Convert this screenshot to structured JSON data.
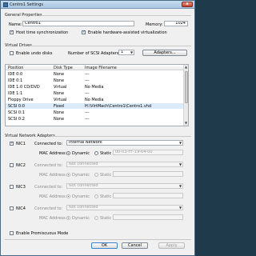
{
  "window": {
    "title": "Centro1 Settings",
    "close_label": "x"
  },
  "general": {
    "group_label": "General Properties",
    "name_label": "Name:",
    "name_value": "Centro1",
    "memory_label": "Memory:",
    "memory_value": "1024",
    "host_time_sync_label": "Host time synchronization",
    "host_time_sync_checked": true,
    "hw_virtualization_label": "Enable hardware-assisted virtualization",
    "hw_virtualization_checked": true
  },
  "virtual_drives": {
    "group_label": "Virtual Drives",
    "undo_disks_label": "Enable undo disks",
    "undo_disks_checked": false,
    "scsi_adapters_label": "Number of SCSI Adapters:",
    "scsi_adapters_value": "1",
    "adapters_button": "Adapters...",
    "columns": [
      "Position",
      "Disk Type",
      "Image Filename"
    ],
    "rows": [
      [
        "IDE 0:0",
        "None",
        "---"
      ],
      [
        "IDE 0:1",
        "None",
        "---"
      ],
      [
        "IDE 1:0 CD/DVD",
        "Virtual",
        "No Media"
      ],
      [
        "IDE 1:1",
        "None",
        "---"
      ],
      [
        "Floppy Drive",
        "Virtual",
        "No Media"
      ],
      [
        "SCSI 0:0",
        "Fixed",
        "H:\\VirtMach\\Centro1\\Centro1.vhd"
      ],
      [
        "SCSI 0:1",
        "None",
        "---"
      ],
      [
        "SCSI 0:2",
        "None",
        "---"
      ]
    ],
    "selected_row": 5
  },
  "network": {
    "group_label": "Virtual Network Adapters",
    "connected_label": "Connected to:",
    "mac_label": "MAC Address:",
    "dynamic_label": "Dynamic",
    "static_label": "Static",
    "adapters": [
      {
        "name": "NIC1",
        "checked": true,
        "connected_to": "Internal Network",
        "mac_mode": "dynamic",
        "mac_value": "00-03-FF-19-64-00"
      },
      {
        "name": "NIC2",
        "checked": false,
        "connected_to": "Not connected",
        "mac_mode": "dynamic",
        "mac_value": ""
      },
      {
        "name": "NIC3",
        "checked": false,
        "connected_to": "Not connected",
        "mac_mode": "dynamic",
        "mac_value": ""
      },
      {
        "name": "NIC4",
        "checked": false,
        "connected_to": "Not connected",
        "mac_mode": "dynamic",
        "mac_value": ""
      }
    ],
    "promiscuous_label": "Enable Promiscuous Mode",
    "promiscuous_checked": false
  },
  "footer": {
    "ok": "OK",
    "cancel": "Cancel",
    "apply": "Apply"
  },
  "icons": {
    "checkmark": "check-icon",
    "dropdown": "chevron-down-icon"
  }
}
